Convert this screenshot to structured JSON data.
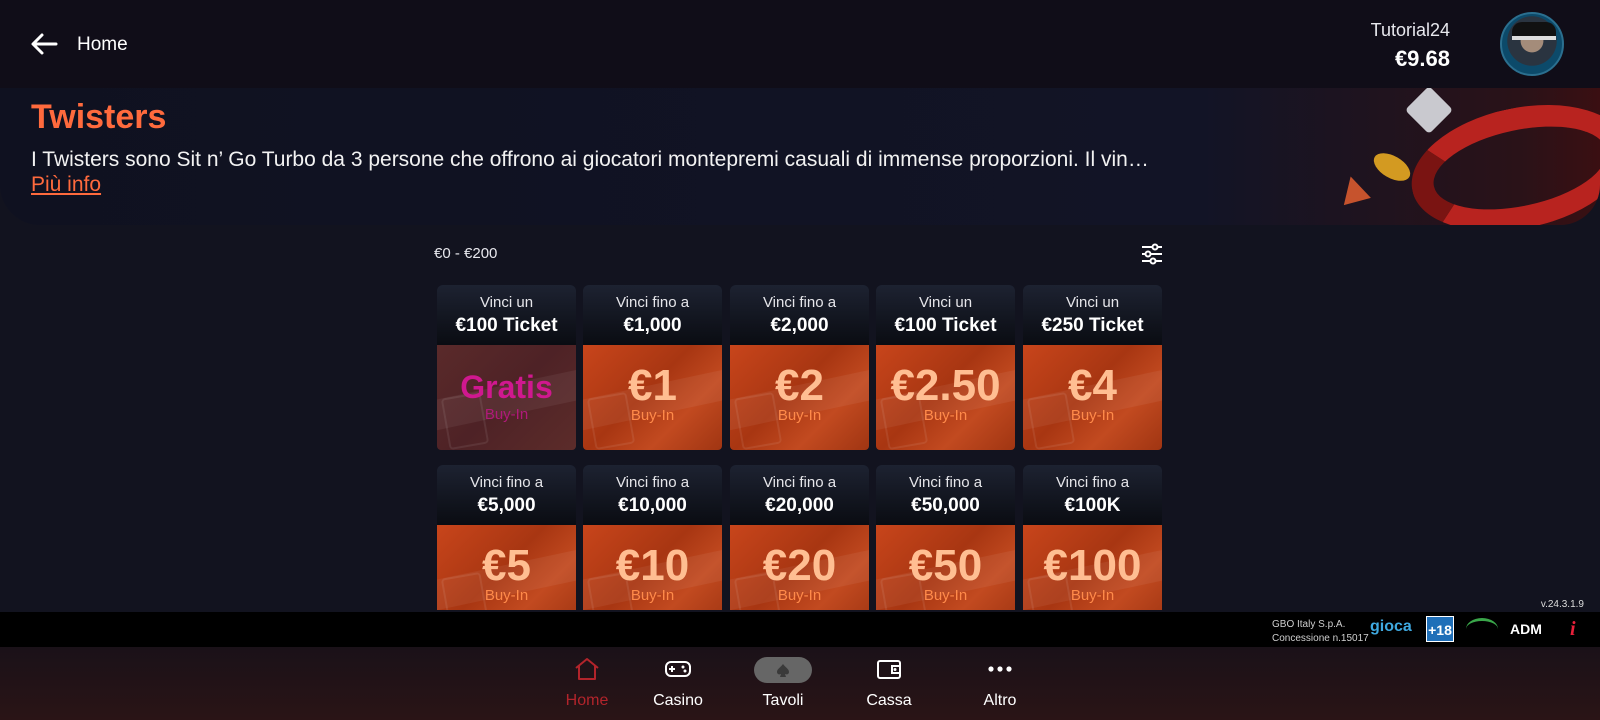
{
  "header": {
    "back_label": "Home",
    "username": "Tutorial24",
    "balance": "€9.68"
  },
  "banner": {
    "title": "Twisters",
    "description": "I Twisters sono Sit n’ Go Turbo da 3 persone che offrono ai giocatori montepremi casuali di immense proporzioni. Il vin…",
    "more_info": "Più info"
  },
  "filter": {
    "range": "€0 - €200"
  },
  "tickets": [
    {
      "line1": "Vinci un",
      "line2": "€100 Ticket",
      "price": "Gratis",
      "buyin": "Buy-In"
    },
    {
      "line1": "Vinci fino a",
      "line2": "€1,000",
      "price": "€1",
      "buyin": "Buy-In"
    },
    {
      "line1": "Vinci fino a",
      "line2": "€2,000",
      "price": "€2",
      "buyin": "Buy-In"
    },
    {
      "line1": "Vinci un",
      "line2": "€100 Ticket",
      "price": "€2.50",
      "buyin": "Buy-In"
    },
    {
      "line1": "Vinci un",
      "line2": "€250 Ticket",
      "price": "€4",
      "buyin": "Buy-In"
    },
    {
      "line1": "Vinci fino a",
      "line2": "€5,000",
      "price": "€5",
      "buyin": "Buy-In"
    },
    {
      "line1": "Vinci fino a",
      "line2": "€10,000",
      "price": "€10",
      "buyin": "Buy-In"
    },
    {
      "line1": "Vinci fino a",
      "line2": "€20,000",
      "price": "€20",
      "buyin": "Buy-In"
    },
    {
      "line1": "Vinci fino a",
      "line2": "€50,000",
      "price": "€50",
      "buyin": "Buy-In"
    },
    {
      "line1": "Vinci fino a",
      "line2": "€100K",
      "price": "€100",
      "buyin": "Buy-In"
    }
  ],
  "footer": {
    "version": "v.24.3.1.9",
    "company": "GBO Italy S.p.A.",
    "concession": "Concessione n.15017",
    "gioca_logo": "gioca",
    "age_badge": "+18",
    "adm_label": "ADM",
    "info_symbol": "i"
  },
  "nav": {
    "items": [
      {
        "label": "Home",
        "icon": "home-icon",
        "active": true
      },
      {
        "label": "Casino",
        "icon": "gamepad-icon",
        "active": false
      },
      {
        "label": "Tavoli",
        "icon": "spade-pill-icon",
        "active": false
      },
      {
        "label": "Cassa",
        "icon": "wallet-icon",
        "active": false
      },
      {
        "label": "Altro",
        "icon": "more-icon",
        "active": false
      }
    ]
  },
  "colors": {
    "accent": "#ff6a3d",
    "active_nav": "#b2242b",
    "ticket": "#c8451b",
    "free_price": "#d0188f"
  }
}
